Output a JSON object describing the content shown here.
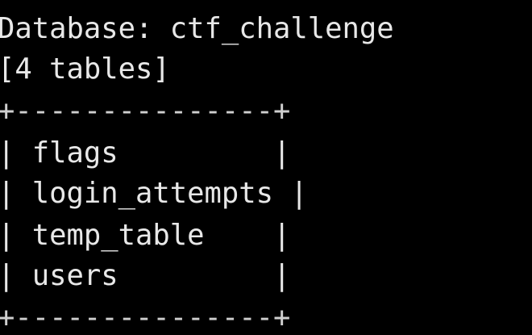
{
  "terminal": {
    "database_line": "Database: ctf_challenge",
    "table_count_line": "[4 tables]",
    "table_border": "+---------------+",
    "rows": [
      "| flags         |",
      "| login_attempts |",
      "| temp_table    |",
      "| users         |"
    ],
    "colors": {
      "background": "#000000",
      "text": "#e8e8e8"
    }
  }
}
